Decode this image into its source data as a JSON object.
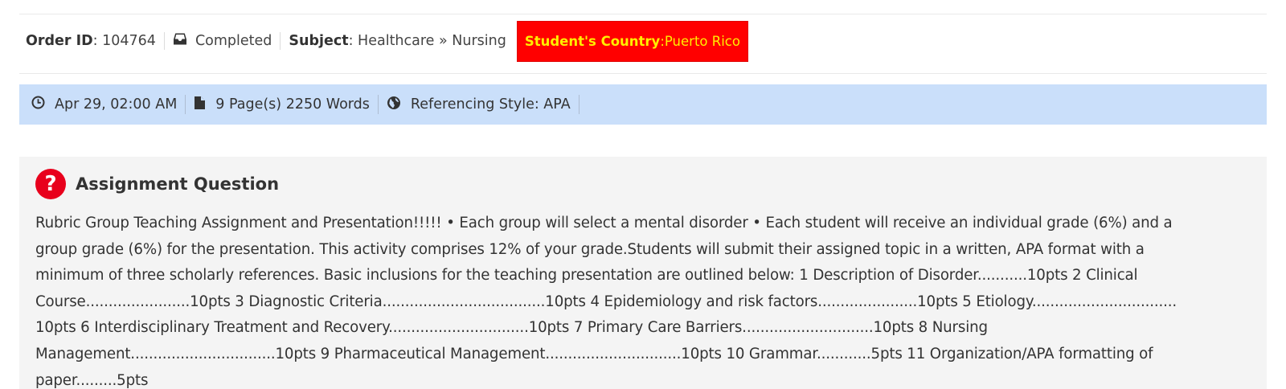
{
  "order": {
    "id_label": "Order ID",
    "id_value": ": 104764",
    "status": "Completed",
    "subject_label": "Subject",
    "subject_value": ": Healthcare » Nursing",
    "country_label": "Student's Country",
    "country_value": ":Puerto Rico"
  },
  "info": {
    "deadline": "Apr 29, 02:00 AM",
    "pages": "9 Page(s) 2250 Words",
    "referencing": "Referencing Style: APA"
  },
  "question": {
    "title": "Assignment Question",
    "icon_glyph": "?",
    "body": "Rubric Group Teaching Assignment and Presentation!!!!! • Each group will select a mental disorder • Each student will receive an individual grade (6%) and a group grade (6%) for the presentation. This activity comprises 12% of your grade.Students will submit their assigned topic in a written, APA format with a minimum of three scholarly references. Basic inclusions for the teaching presentation are outlined below: 1 Description of Disorder...........10pts 2 Clinical Course.......................10pts 3 Diagnostic Criteria....................................10pts 4 Epidemiology and risk factors......................10pts 5 Etiology................................ 10pts 6 Interdisciplinary Treatment and Recovery...............................10pts 7 Primary Care Barriers.............................10pts 8 Nursing Management................................10pts 9 Pharmaceutical Management..............................10pts 10 Grammar............5pts 11 Organization/APA formatting of paper.........5pts"
  },
  "colors": {
    "info_bar_bg": "#cadffa",
    "badge_bg": "#ff0000",
    "badge_text": "#ffee00",
    "question_icon_bg": "#e8001c",
    "question_box_bg": "#f4f4f4"
  },
  "icons": {
    "status": "inbox-icon",
    "deadline": "clock-icon",
    "pages": "file-icon",
    "referencing": "globe-icon",
    "question": "question-circle-icon"
  }
}
